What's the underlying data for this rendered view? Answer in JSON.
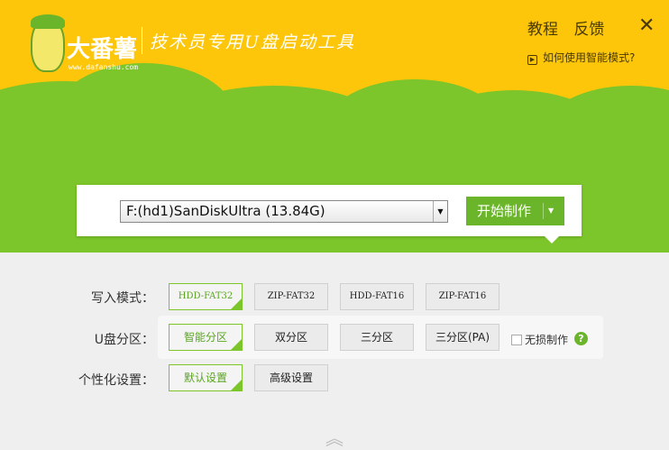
{
  "header": {
    "logo_text": "大番薯",
    "logo_url": "www.dafanshu.com",
    "slogan": "技术员专用U盘启动工具",
    "links": [
      "教程",
      "反馈"
    ],
    "close": "✕",
    "mode_help": "如何使用智能模式?"
  },
  "drive": {
    "selected": "F:(hd1)SanDiskUltra (13.84G)",
    "start_label": "开始制作"
  },
  "rows": [
    {
      "label": "写入模式：",
      "options": [
        "HDD-FAT32",
        "ZIP-FAT32",
        "HDD-FAT16",
        "ZIP-FAT16"
      ],
      "selected": 0
    },
    {
      "label": "U盘分区：",
      "options": [
        "智能分区",
        "双分区",
        "三分区",
        "三分区(PA)"
      ],
      "selected": 0
    },
    {
      "label": "个性化设置：",
      "options": [
        "默认设置",
        "高级设置"
      ],
      "selected": 0
    }
  ],
  "lossless": {
    "label": "无损制作",
    "checked": false,
    "help": "?"
  },
  "colors": {
    "yellow": "#fdc60a",
    "green": "#7cc52a",
    "accent": "#6bb52a"
  }
}
